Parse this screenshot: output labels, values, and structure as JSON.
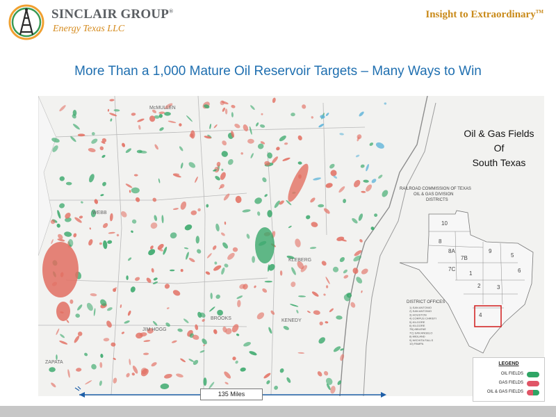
{
  "header": {
    "brand_name": "SINCLAIR GROUP",
    "brand_mark": "®",
    "brand_sub": "Energy Texas LLC",
    "tagline": "Insight to Extraordinary",
    "tagline_mark": "TM"
  },
  "headline": "More Than a 1,000 Mature Oil Reservoir Targets – Many Ways to Win",
  "map": {
    "caption": [
      "Oil & Gas Fields",
      "Of",
      "South Texas"
    ],
    "labels": {
      "county_1": "McMULLEN",
      "county_2": "ZAPATA",
      "county_3": "JIM HOGG",
      "county_4": "BROOKS",
      "county_5": "KENEDY",
      "county_6": "KLEBERG",
      "county_7": "WEBB",
      "rrc_title_1": "RAILROAD COMMISSION OF TEXAS",
      "rrc_title_2": "OIL & GAS DIVISION",
      "rrc_title_3": "DISTRICTS",
      "district_offices": "DISTRICT OFFICES"
    },
    "district_numbers": [
      "10",
      "8",
      "8A",
      "7B",
      "7C",
      "9",
      "5",
      "6",
      "1",
      "2",
      "3",
      "4"
    ],
    "district_office_list": [
      "1) SAN ANTONIO",
      "2) SAN ANTONIO",
      "3) HOUSTON",
      "4) CORPUS CHRISTI",
      "5) KILGORE",
      "6) KILGORE",
      "7B) ABILENE",
      "7C) SAN ANGELO",
      "8) MIDLAND",
      "9) WICHITA FALLS",
      "10) PAMPA"
    ]
  },
  "legend": {
    "title": "LEGEND",
    "items": [
      {
        "label": "OIL FIELDS",
        "color": "#2fa565"
      },
      {
        "label": "GAS FIELDS",
        "color": "#e05566"
      },
      {
        "label": "OIL & GAS FIELDS",
        "color": "#e05566",
        "color2": "#2fa565"
      }
    ]
  },
  "scale_bar": {
    "label": "135 Miles"
  },
  "colors": {
    "headline": "#1f6fb0",
    "oil": "#3aa86b",
    "gas": "#e26f62",
    "water": "#5ab2d8",
    "footer": "#c7c7c7"
  }
}
